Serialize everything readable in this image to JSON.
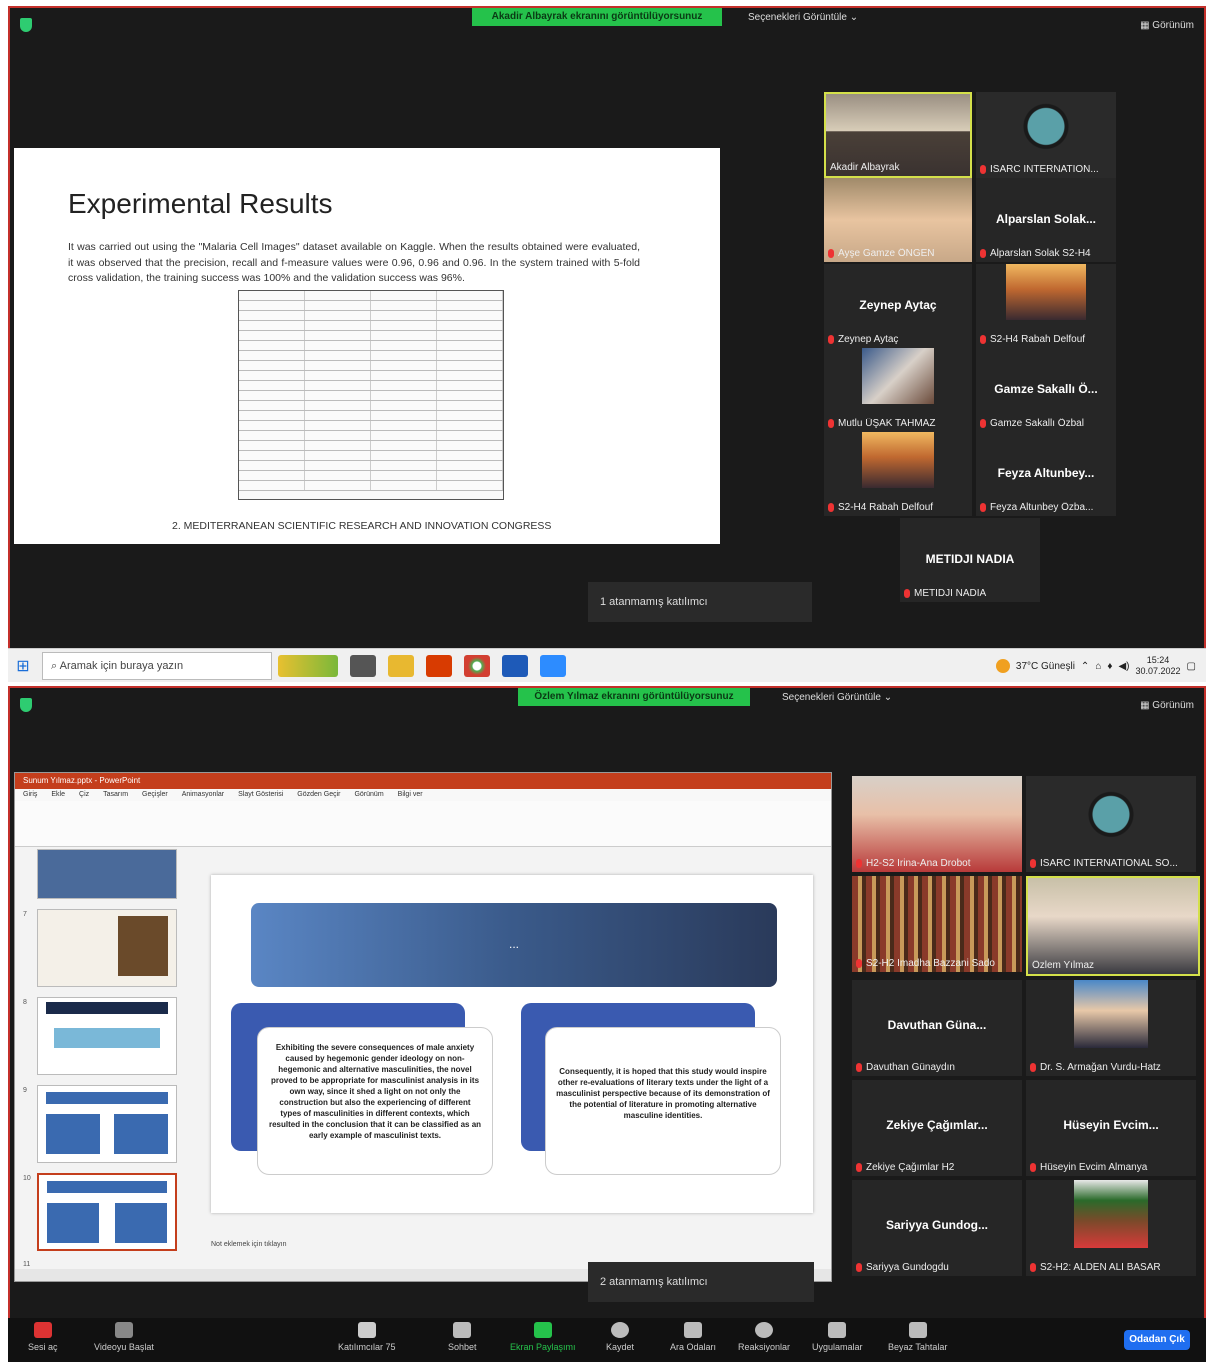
{
  "top": {
    "share_banner": "Akadir Albayrak ekranını görüntülüyorsunuz",
    "view_selector": "Seçenekleri Görüntüle  ⌄",
    "view_button": "▦ Görünüm",
    "slide": {
      "title": "Experimental Results",
      "body": "It was carried out using the \"Malaria Cell Images\" dataset available on Kaggle. When the results obtained were evaluated, it was observed that the precision, recall and f-measure values were 0.96, 0.96 and 0.96. In the system trained with 5-fold cross validation, the training success was 100% and the validation success was 96%.",
      "footer": "2. MEDITERRANEAN SCIENTIFIC RESEARCH AND INNOVATION CONGRESS"
    },
    "tooltip": "1 atanmamış katılımcı",
    "participants": [
      {
        "label": "Akadir Albayrak"
      },
      {
        "label": "ISARC INTERNATION..."
      },
      {
        "label": "Ayşe Gamze ÖNGEN"
      },
      {
        "name": "Alparslan Solak...",
        "label": "Alparslan Solak S2-H4"
      },
      {
        "name": "Zeynep Aytaç",
        "label": "Zeynep Aytaç"
      },
      {
        "label": "S2-H4 Rabah Delfouf"
      },
      {
        "label": "Mutlu ÜŞAK TAHMAZ"
      },
      {
        "name": "Gamze Sakallı Ö...",
        "label": "Gamze Sakallı Özbal"
      },
      {
        "label": "S2-H4 Rabah Delfouf"
      },
      {
        "name": "Feyza Altunbey...",
        "label": "Feyza Altunbey Özba..."
      },
      {
        "name": "METIDJI NADIA",
        "label": "METIDJI NADIA"
      }
    ]
  },
  "taskbar": {
    "search_placeholder": "Aramak için buraya yazın",
    "weather": "37°C  Güneşli",
    "time": "15:24",
    "date": "30.07.2022"
  },
  "bottom": {
    "share_banner": "Özlem Yılmaz ekranını görüntülüyorsunuz",
    "view_selector": "Seçenekleri Görüntüle  ⌄",
    "view_button": "▦ Görünüm",
    "pp_title": "Sunum Yılmaz.pptx - PowerPoint",
    "pp_menu": [
      "Giriş",
      "Ekle",
      "Çiz",
      "Tasarım",
      "Geçişler",
      "Animasyonlar",
      "Slayt Gösterisi",
      "Gözden Geçir",
      "Görünüm",
      "Bilgi ver"
    ],
    "pp_slide": {
      "banner_dots": "...",
      "left_card": "Exhibiting the severe consequences of male anxiety caused by hegemonic gender ideology on non-hegemonic and alternative masculinities, the novel proved to be appropriate for masculinist analysis in its own way, since it shed a light on not only the construction but also the experiencing of different types of masculinities in different contexts, which resulted in the conclusion that it can be classified as an early example of masculinist texts.",
      "right_card": "Consequently, it is hoped that this study would inspire other re-evaluations of literary texts under the light of a masculinist perspective because of its demonstration of the potential of literature in promoting alternative masculine identities."
    },
    "pp_notes": "Not eklemek için tıklayın",
    "thumb_numbers": [
      "7",
      "8",
      "9",
      "10",
      "11"
    ],
    "tooltip": "2 atanmamış katılımcı",
    "participants": [
      {
        "label": "H2-S2 Irina-Ana Drobot"
      },
      {
        "label": "ISARC INTERNATIONAL SO..."
      },
      {
        "label": "S2-H2 Imadha Bazzani Sado"
      },
      {
        "label": "Özlem Yılmaz"
      },
      {
        "name": "Davuthan Güna...",
        "label": "Davuthan Günaydın"
      },
      {
        "label": "Dr. S. Armağan Vurdu-Hatz"
      },
      {
        "name": "Zekiye Çağımlar...",
        "label": "Zekiye Çağımlar H2"
      },
      {
        "name": "Hüseyin Evcim...",
        "label": "Hüseyin Evcim Almanya"
      },
      {
        "name": "Sariyya Gundog...",
        "label": "Sariyya Gundogdu"
      },
      {
        "label": "S2-H2: ALDEN ALI BASAR"
      }
    ]
  },
  "controls": {
    "mute": "Sesi aç",
    "video": "Videoyu Başlat",
    "participants": "Katılımcılar",
    "participants_count": "75",
    "chat": "Sohbet",
    "share": "Ekran Paylaşımı",
    "record": "Kaydet",
    "breakout": "Ara Odaları",
    "reactions": "Reaksiyonlar",
    "apps": "Uygulamalar",
    "whiteboard": "Beyaz Tahtalar",
    "leave": "Odadan Çık"
  }
}
